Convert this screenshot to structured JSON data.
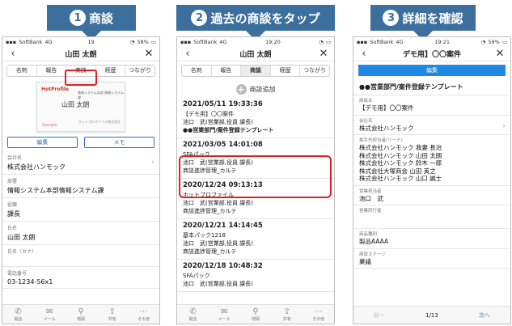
{
  "banners": [
    {
      "num": "1",
      "text": "商談"
    },
    {
      "num": "2",
      "text": "過去の商談をタップ"
    },
    {
      "num": "3",
      "text": "詳細を確認"
    }
  ],
  "status": {
    "carrier": "SoftBank",
    "network": "4G",
    "screen1_time": "19",
    "screen2_time": "19:20",
    "screen3_time": "19:21",
    "screen1_battery": "58%",
    "screen2_battery": "",
    "screen3_battery": "59%"
  },
  "screen1": {
    "title": "山田 太朗",
    "tabs": [
      "名刺",
      "報告",
      "商談",
      "経歴",
      "つながり"
    ],
    "card": {
      "logo": "HotProfile",
      "company_line": "情報システム本部 情報システム課",
      "name": "山田 太朗",
      "address": "ホットプロファイル株式会社",
      "sample": "Sample"
    },
    "edit_label": "編集",
    "memo_label": "メモ",
    "fields": [
      {
        "label": "会社名",
        "value": "株式会社ハンモック",
        "chev": "›"
      },
      {
        "label": "部署",
        "value": "情報システム本部情報システム課",
        "chev": ""
      },
      {
        "label": "役職",
        "value": "課長",
        "chev": ""
      },
      {
        "label": "氏名",
        "value": "山田 太朗",
        "chev": ""
      },
      {
        "label": "氏名（カナ）",
        "value": "",
        "chev": ""
      },
      {
        "label": "電話番号",
        "value": "03-1234-56x1",
        "chev": ""
      }
    ]
  },
  "screen2": {
    "title": "山田 太朗",
    "tabs": [
      "名刺",
      "報告",
      "商談",
      "経歴",
      "つながり"
    ],
    "add_label": "商談追加",
    "meetings": [
      {
        "date": "2021/05/11 19:33:36",
        "lines": [
          "【デモ用】〇〇案件",
          "池口　武(営業部,役員 課長)",
          "●●営業部門/案件登録テンプレート"
        ]
      },
      {
        "date": "2021/03/05 14:01:08",
        "lines": [
          "SFAパック",
          "池口　武(営業部,役員 課長)",
          "商談進捗管理_カルテ"
        ]
      },
      {
        "date": "2020/12/24 09:13:13",
        "lines": [
          "ホットプロファイル",
          "池口　武(営業部,役員 課長)",
          "商談進捗管理_カルテ"
        ]
      },
      {
        "date": "2020/12/21 14:14:45",
        "lines": [
          "基本パック1218",
          "池口　武(営業部,役員 課長)",
          "商談進捗管理_カルテ"
        ]
      },
      {
        "date": "2020/12/18 10:48:32",
        "lines": [
          "SFAパック",
          "池口　武(営業部,役員 課長)",
          ""
        ]
      }
    ]
  },
  "screen3": {
    "title": "デモ用】〇〇案件",
    "edit_label": "編集",
    "template": "●●営業部門/案件登録テンプレート",
    "fields": [
      {
        "label": "商談名",
        "value": "【デモ用】〇〇案件",
        "chev": ""
      },
      {
        "label": "会社名",
        "value": "株式会社ハンモック",
        "chev": "›"
      },
      {
        "label": "相手先担当者(リード)",
        "value": "株式会社ハンモック 我妻 長治\n株式会社ハンモック 山田 太朗\n株式会社ハンモック 鈴木 一郎\n株式会社大塚商会 山田 英之\n株式会社ハンモック 山口 誠士",
        "chev": ""
      },
      {
        "label": "営業担当者",
        "value": "池口　武",
        "chev": ""
      },
      {
        "label": "営業同行者",
        "value": "",
        "chev": ""
      },
      {
        "label": "商品種別",
        "value": "製品AAAA",
        "chev": ""
      },
      {
        "label": "商談ステージ",
        "value": "業議",
        "chev": ""
      }
    ],
    "pager": {
      "prev": "前へ",
      "position": "1/13",
      "next": "次へ"
    }
  },
  "bottom_nav": [
    "電話",
    "メール",
    "地図",
    "共有",
    "その他"
  ]
}
